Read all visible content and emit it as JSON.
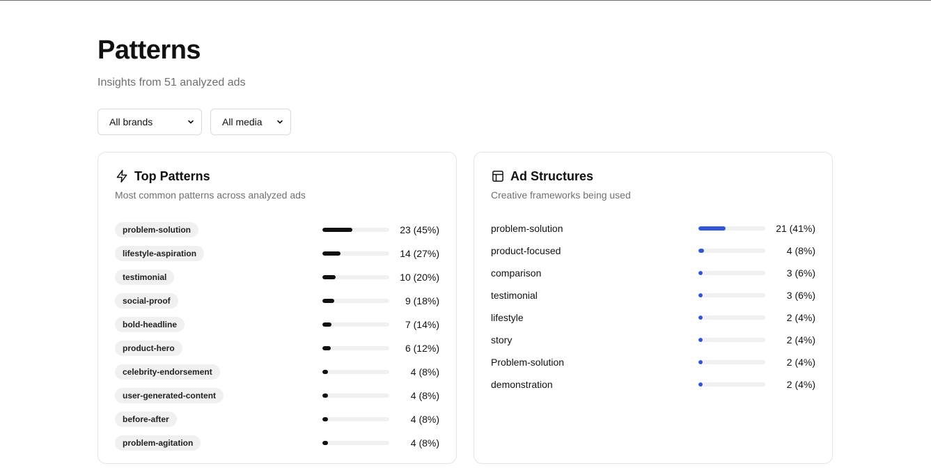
{
  "header": {
    "title": "Patterns",
    "subtitle": "Insights from 51 analyzed ads"
  },
  "filters": {
    "brands": "All brands",
    "media": "All media"
  },
  "top_patterns": {
    "title": "Top Patterns",
    "subtitle": "Most common patterns across analyzed ads",
    "icon": "lightning-icon",
    "accent": "#111111",
    "items": [
      {
        "label": "problem-solution",
        "value": "23 (45%)",
        "pct": 45
      },
      {
        "label": "lifestyle-aspiration",
        "value": "14 (27%)",
        "pct": 27
      },
      {
        "label": "testimonial",
        "value": "10 (20%)",
        "pct": 20
      },
      {
        "label": "social-proof",
        "value": "9 (18%)",
        "pct": 18
      },
      {
        "label": "bold-headline",
        "value": "7 (14%)",
        "pct": 14
      },
      {
        "label": "product-hero",
        "value": "6 (12%)",
        "pct": 12
      },
      {
        "label": "celebrity-endorsement",
        "value": "4 (8%)",
        "pct": 8
      },
      {
        "label": "user-generated-content",
        "value": "4 (8%)",
        "pct": 8
      },
      {
        "label": "before-after",
        "value": "4 (8%)",
        "pct": 8
      },
      {
        "label": "problem-agitation",
        "value": "4 (8%)",
        "pct": 8
      }
    ]
  },
  "ad_structures": {
    "title": "Ad Structures",
    "subtitle": "Creative frameworks being used",
    "icon": "layout-icon",
    "accent": "#2f56d4",
    "items": [
      {
        "label": "problem-solution",
        "value": "21 (41%)",
        "pct": 41
      },
      {
        "label": "product-focused",
        "value": "4 (8%)",
        "pct": 8
      },
      {
        "label": "comparison",
        "value": "3 (6%)",
        "pct": 6
      },
      {
        "label": "testimonial",
        "value": "3 (6%)",
        "pct": 6
      },
      {
        "label": "lifestyle",
        "value": "2 (4%)",
        "pct": 4
      },
      {
        "label": "story",
        "value": "2 (4%)",
        "pct": 4
      },
      {
        "label": "Problem-solution",
        "value": "2 (4%)",
        "pct": 4
      },
      {
        "label": "demonstration",
        "value": "2 (4%)",
        "pct": 4
      }
    ]
  }
}
